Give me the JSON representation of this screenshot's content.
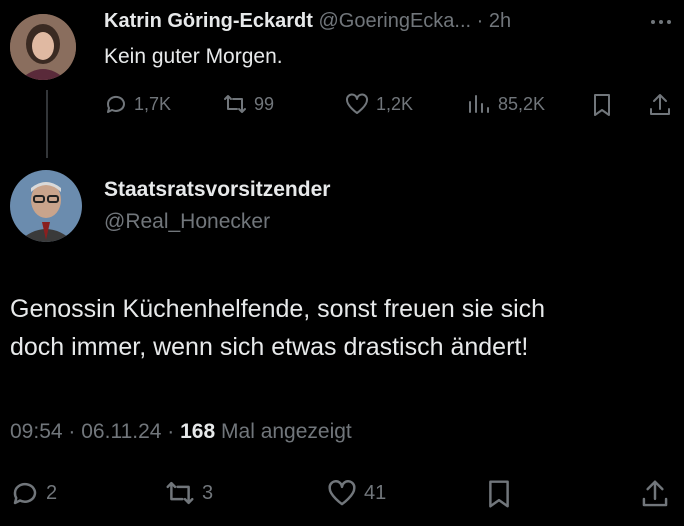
{
  "first_post": {
    "author_name": "Katrin Göring-Eckardt",
    "author_handle": "@GoeringEcka...",
    "separator": "·",
    "age": "2h",
    "more_icon": "more-icon",
    "text": "Kein guter Morgen.",
    "actions": {
      "reply_count": "1,7K",
      "repost_count": "99",
      "like_count": "1,2K",
      "view_count": "85,2K"
    }
  },
  "second_post": {
    "author_name": "Staatsratsvorsitzender",
    "author_handle": "@Real_Honecker",
    "text_line1": "Genossin Küchenhelfende, sonst freuen sie sich",
    "text_line2": "doch immer, wenn sich etwas drastisch ändert!",
    "meta": {
      "time": "09:54",
      "sep1": "·",
      "date": "06.11.24",
      "sep2": "·",
      "views_number": "168",
      "views_label": "Mal angezeigt"
    },
    "actions": {
      "reply_count": "2",
      "repost_count": "3",
      "like_count": "41"
    }
  },
  "colors": {
    "background": "#000000",
    "text": "#e7e9ea",
    "muted": "#71767b"
  }
}
